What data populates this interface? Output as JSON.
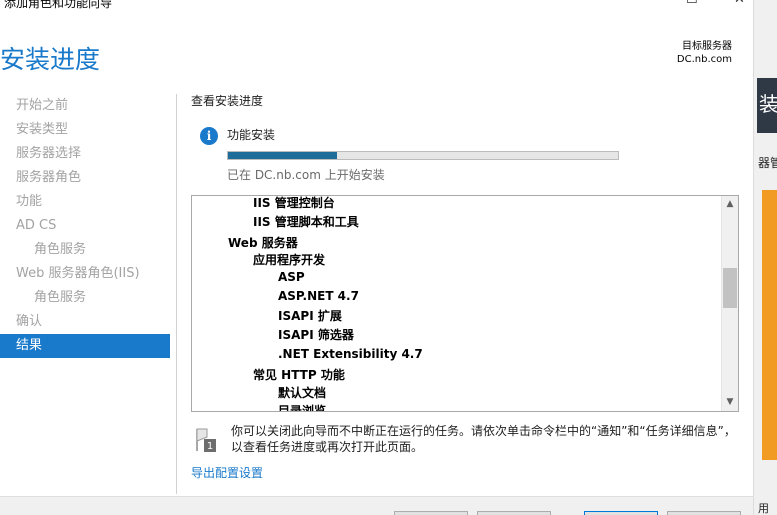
{
  "window": {
    "title": "添加角色和功能向导",
    "maximize_glyph": "☐",
    "close_glyph": "✕"
  },
  "header": {
    "page_title": "安装进度",
    "dest_label": "目标服务器",
    "dest_server": "DC.nb.com"
  },
  "nav": {
    "items": [
      {
        "label": "开始之前"
      },
      {
        "label": "安装类型"
      },
      {
        "label": "服务器选择"
      },
      {
        "label": "服务器角色"
      },
      {
        "label": "功能"
      },
      {
        "label": "AD CS"
      },
      {
        "label": "角色服务"
      },
      {
        "label": "Web 服务器角色(IIS)"
      },
      {
        "label": "角色服务"
      },
      {
        "label": "确认"
      },
      {
        "label": "结果"
      }
    ]
  },
  "content": {
    "section_label": "查看安装进度",
    "info_icon_glyph": "i",
    "feature_title": "功能安装",
    "progress_percent": 28,
    "progress_status": "已在 DC.nb.com 上开始安装",
    "features_list": [
      "IIS 管理控制台",
      "IIS 管理脚本和工具",
      "Web 服务器",
      "应用程序开发",
      "ASP",
      "ASP.NET 4.7",
      "ISAPI 扩展",
      "ISAPI 筛选器",
      ".NET Extensibility 4.7",
      "常见 HTTP 功能",
      "默认文档",
      "目录浏览"
    ],
    "scroll_up_glyph": "▲",
    "scroll_down_glyph": "▼",
    "note_text": "你可以关闭此向导而不中断正在运行的任务。请依次单击命令栏中的“通知”和“任务详细信息”，以查看任务进度或再次打开此页面。",
    "note_icon_number": "1",
    "export_link": "导出配置设置"
  },
  "background_window": {
    "dark_tile_char": "装",
    "text_fragment": "器管",
    "bottom_text": "用"
  },
  "colors": {
    "accent": "#1979ca",
    "progress": "#1f6e9a",
    "nav_inactive": "#a3a3a3",
    "orange": "#f29b24"
  }
}
